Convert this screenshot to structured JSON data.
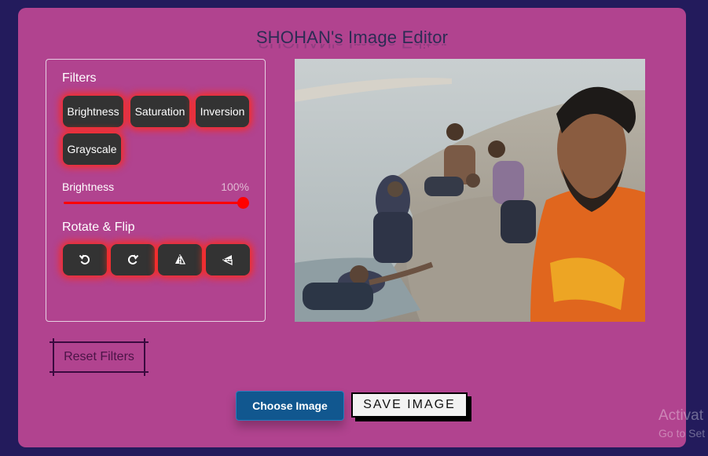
{
  "app": {
    "title": "SHOHAN's Image Editor"
  },
  "filters": {
    "heading": "Filters",
    "buttons": [
      "Brightness",
      "Saturation",
      "Inversion",
      "Grayscale"
    ],
    "active": "Brightness"
  },
  "slider": {
    "label": "Brightness",
    "value": "100%",
    "level": 1.0
  },
  "rotate": {
    "heading": "Rotate & Flip",
    "icons": [
      "rotate-left-icon",
      "rotate-right-icon",
      "flip-horizontal-icon",
      "flip-vertical-icon"
    ]
  },
  "actions": {
    "reset": "Reset Filters",
    "choose": "Choose Image",
    "save": "SAVE IMAGE"
  },
  "watermark": {
    "line1": "Activat",
    "line2": "Go to Set"
  },
  "colors": {
    "background": "#231b5c",
    "card": "#b1438f",
    "accent_glow": "#ff2a1a",
    "slider": "#ff0000",
    "choose_button": "#11578f"
  }
}
